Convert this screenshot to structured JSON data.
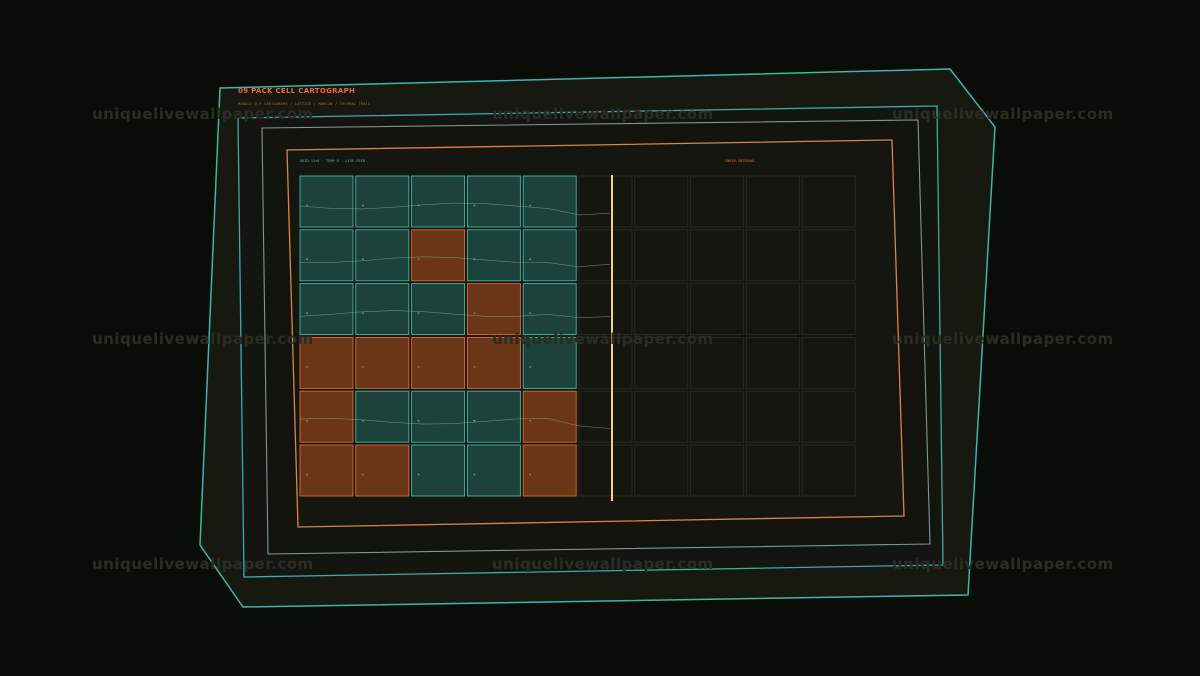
{
  "header": {
    "title": "09 PACK CELL CARTOGRAPH",
    "subtitle": "MODULE 0-9 CARTOGRAPH / LATTICE / MARGIN / THERMAL TRAIL",
    "meta_left": "GRID 11×6 · TEMP 8 · LIVE FEED",
    "meta_right": "SWEEP INTERVAL"
  },
  "watermark": {
    "text": "uniquelivewallpaper.com"
  },
  "colors": {
    "background": "#0a0c07",
    "panel": "#171810",
    "teal": "#3bb5b0",
    "orange": "#e08040",
    "cell_teal_fill": "#1d423c",
    "cell_teal_stroke": "#3fb6ad",
    "cell_orange_fill": "#6b3517",
    "cell_orange_stroke": "#e06a2f",
    "cell_empty_stroke": "#2b2d22",
    "sweep_line": "#f2d27a"
  },
  "grid": {
    "columns": 10,
    "rows": 6,
    "sweep_after_column": 5,
    "cells": [
      [
        "teal",
        "teal",
        "teal",
        "teal",
        "teal",
        "empty",
        "empty",
        "empty",
        "empty",
        "empty"
      ],
      [
        "teal",
        "teal",
        "orange",
        "teal",
        "teal",
        "empty",
        "empty",
        "empty",
        "empty",
        "empty"
      ],
      [
        "teal",
        "teal",
        "teal",
        "orange",
        "teal",
        "empty",
        "empty",
        "empty",
        "empty",
        "empty"
      ],
      [
        "orange",
        "orange",
        "orange",
        "orange",
        "teal",
        "empty",
        "empty",
        "empty",
        "empty",
        "empty"
      ],
      [
        "orange",
        "teal",
        "teal",
        "teal",
        "orange",
        "empty",
        "empty",
        "empty",
        "empty",
        "empty"
      ],
      [
        "orange",
        "orange",
        "teal",
        "teal",
        "orange",
        "empty",
        "empty",
        "empty",
        "empty",
        "empty"
      ]
    ]
  }
}
